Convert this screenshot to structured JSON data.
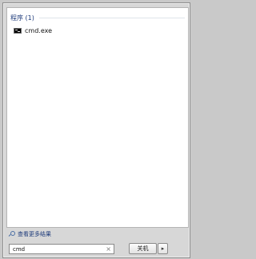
{
  "results": {
    "section_title": "程序 (1)",
    "items": [
      {
        "label": "cmd.exe",
        "icon": "cmd-icon"
      }
    ]
  },
  "see_more": {
    "label": "查看更多结果",
    "icon": "search-icon"
  },
  "search": {
    "value": "cmd",
    "clear_icon": "close-icon"
  },
  "shutdown": {
    "label": "关机",
    "menu_glyph": "▸"
  }
}
